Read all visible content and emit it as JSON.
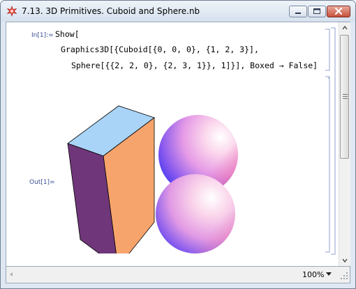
{
  "window": {
    "title": "7.13. 3D Primitives. Cuboid and Sphere.nb"
  },
  "cell_input": {
    "label": "In[1]:=",
    "lines": [
      "Show[",
      "Graphics3D[{Cuboid[{0, 0, 0}, {1, 2, 3}],",
      "Sphere[{{2, 2, 0}, {2, 3, 1}}, 1]}], Boxed → False]"
    ]
  },
  "cell_output": {
    "label": "Out[1]=",
    "graphic": {
      "objects": [
        "cuboid",
        "sphere",
        "sphere"
      ],
      "colors": {
        "cuboid_top": "#a9d4f7",
        "cuboid_front": "#f7a46c",
        "cuboid_side": "#6f3679",
        "sphere_blue": "#3a3cf0",
        "sphere_pink": "#f49ac2"
      }
    }
  },
  "statusbar": {
    "zoom": "100%"
  },
  "icons": {
    "app": "mathematica-star-icon",
    "minimize": "minimize-icon",
    "maximize": "maximize-icon",
    "close": "close-icon"
  }
}
